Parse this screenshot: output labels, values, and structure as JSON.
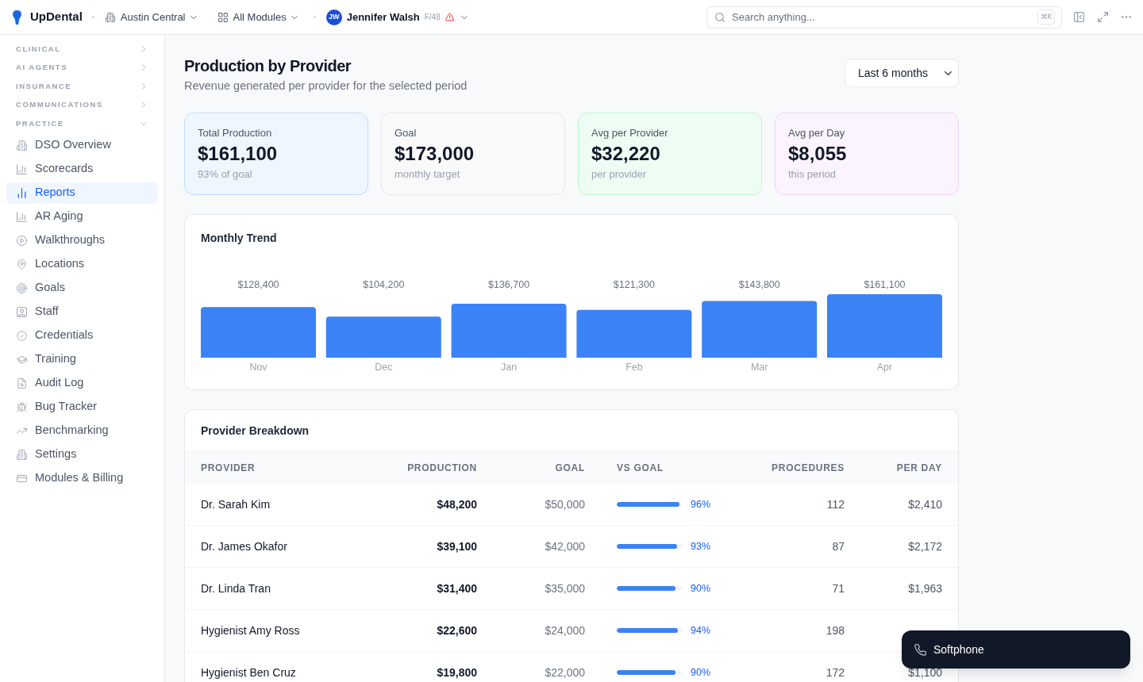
{
  "topbar": {
    "brand": "UpDental",
    "location": "Austin Central",
    "modules": "All Modules",
    "user": {
      "initials": "JW",
      "name": "Jennifer Walsh",
      "tag": "F/48",
      "warning": true
    },
    "search": {
      "placeholder": "Search anything...",
      "shortcut": "⌘K"
    }
  },
  "sidebar": {
    "sections": [
      {
        "label": "CLINICAL",
        "expanded": false
      },
      {
        "label": "AI AGENTS",
        "expanded": false
      },
      {
        "label": "INSURANCE",
        "expanded": false
      },
      {
        "label": "COMMUNICATIONS",
        "expanded": false
      },
      {
        "label": "PRACTICE",
        "expanded": true,
        "items": [
          {
            "label": "DSO Overview",
            "selected": false
          },
          {
            "label": "Scorecards",
            "selected": false
          },
          {
            "label": "Reports",
            "selected": true
          },
          {
            "label": "AR Aging",
            "selected": false
          },
          {
            "label": "Walkthroughs",
            "selected": false
          },
          {
            "label": "Locations",
            "selected": false
          },
          {
            "label": "Goals",
            "selected": false
          },
          {
            "label": "Staff",
            "selected": false
          },
          {
            "label": "Credentials",
            "selected": false
          },
          {
            "label": "Training",
            "selected": false
          },
          {
            "label": "Audit Log",
            "selected": false
          },
          {
            "label": "Bug Tracker",
            "selected": false
          },
          {
            "label": "Benchmarking",
            "selected": false
          },
          {
            "label": "Settings",
            "selected": false
          },
          {
            "label": "Modules & Billing",
            "selected": false
          }
        ]
      }
    ]
  },
  "header": {
    "title": "Production by Provider",
    "subtitle": "Revenue generated per provider for the selected period",
    "period": "Last 6 months"
  },
  "stats": [
    {
      "label": "Total Production",
      "value": "$161,100",
      "note": "93% of goal",
      "color": "#bfdbfe"
    },
    {
      "label": "Goal",
      "value": "$173,000",
      "note": "monthly target",
      "color": "#e5e7eb"
    },
    {
      "label": "Avg per Provider",
      "value": "$32,220",
      "note": "per provider",
      "color": "#bbf7d0"
    },
    {
      "label": "Avg per Day",
      "value": "$8,055",
      "note": "this period",
      "color": "#f0d4fb"
    }
  ],
  "trend": {
    "title": "Monthly Trend",
    "chart_data": {
      "type": "bar",
      "categories": [
        "Nov",
        "Dec",
        "Jan",
        "Feb",
        "Mar",
        "Apr"
      ],
      "values": [
        128400,
        104200,
        136700,
        121300,
        143800,
        161100
      ],
      "value_labels": [
        "$128,400",
        "$104,200",
        "$136,700",
        "$121,300",
        "$143,800",
        "$161,100"
      ]
    }
  },
  "breakdown": {
    "title": "Provider Breakdown",
    "columns": [
      "PROVIDER",
      "PRODUCTION",
      "GOAL",
      "VS GOAL",
      "PROCEDURES",
      "PER DAY"
    ],
    "rows": [
      {
        "provider": "Dr. Sarah Kim",
        "production": "$48,200",
        "goal": "$50,000",
        "level": 0.96,
        "vs_goal": "96%",
        "procedures": "112",
        "per_day": "$2,410"
      },
      {
        "provider": "Dr. James Okafor",
        "production": "$39,100",
        "goal": "$42,000",
        "level": 0.93,
        "vs_goal": "93%",
        "procedures": "87",
        "per_day": "$2,172"
      },
      {
        "provider": "Dr. Linda Tran",
        "production": "$31,400",
        "goal": "$35,000",
        "level": 0.9,
        "vs_goal": "90%",
        "procedures": "71",
        "per_day": "$1,963"
      },
      {
        "provider": "Hygienist Amy Ross",
        "production": "$22,600",
        "goal": "$24,000",
        "level": 0.94,
        "vs_goal": "94%",
        "procedures": "198"
      },
      {
        "provider": "Hygienist Ben Cruz",
        "production": "$19,800",
        "goal": "$22,000",
        "level": 0.9,
        "vs_goal": "90%",
        "procedures": "172",
        "per_day": "$1,100"
      }
    ]
  },
  "softphone": {
    "label": "Softphone"
  }
}
